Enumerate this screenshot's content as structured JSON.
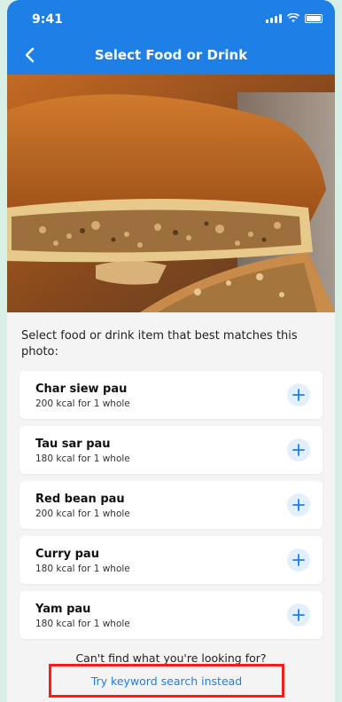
{
  "status_bar": {
    "time": "9:41"
  },
  "nav": {
    "title": "Select Food or Drink"
  },
  "main": {
    "prompt": "Select food or drink item that best matches this photo:",
    "items": [
      {
        "name": "Char siew pau",
        "kcal": "200 kcal for 1 whole"
      },
      {
        "name": "Tau sar pau",
        "kcal": "180 kcal for 1 whole"
      },
      {
        "name": "Red bean pau",
        "kcal": "200 kcal for 1 whole"
      },
      {
        "name": "Curry pau",
        "kcal": "180 kcal for 1 whole"
      },
      {
        "name": "Yam pau",
        "kcal": "180 kcal for 1 whole"
      }
    ],
    "footer_question": "Can't find what you're looking for?",
    "keyword_link": "Try keyword search instead"
  },
  "colors": {
    "header": "#1e7fe6",
    "accent": "#1e7fe6",
    "highlight_box": "#ff1a1a"
  },
  "icons": {
    "back": "chevron-left-icon",
    "add": "plus-icon"
  }
}
